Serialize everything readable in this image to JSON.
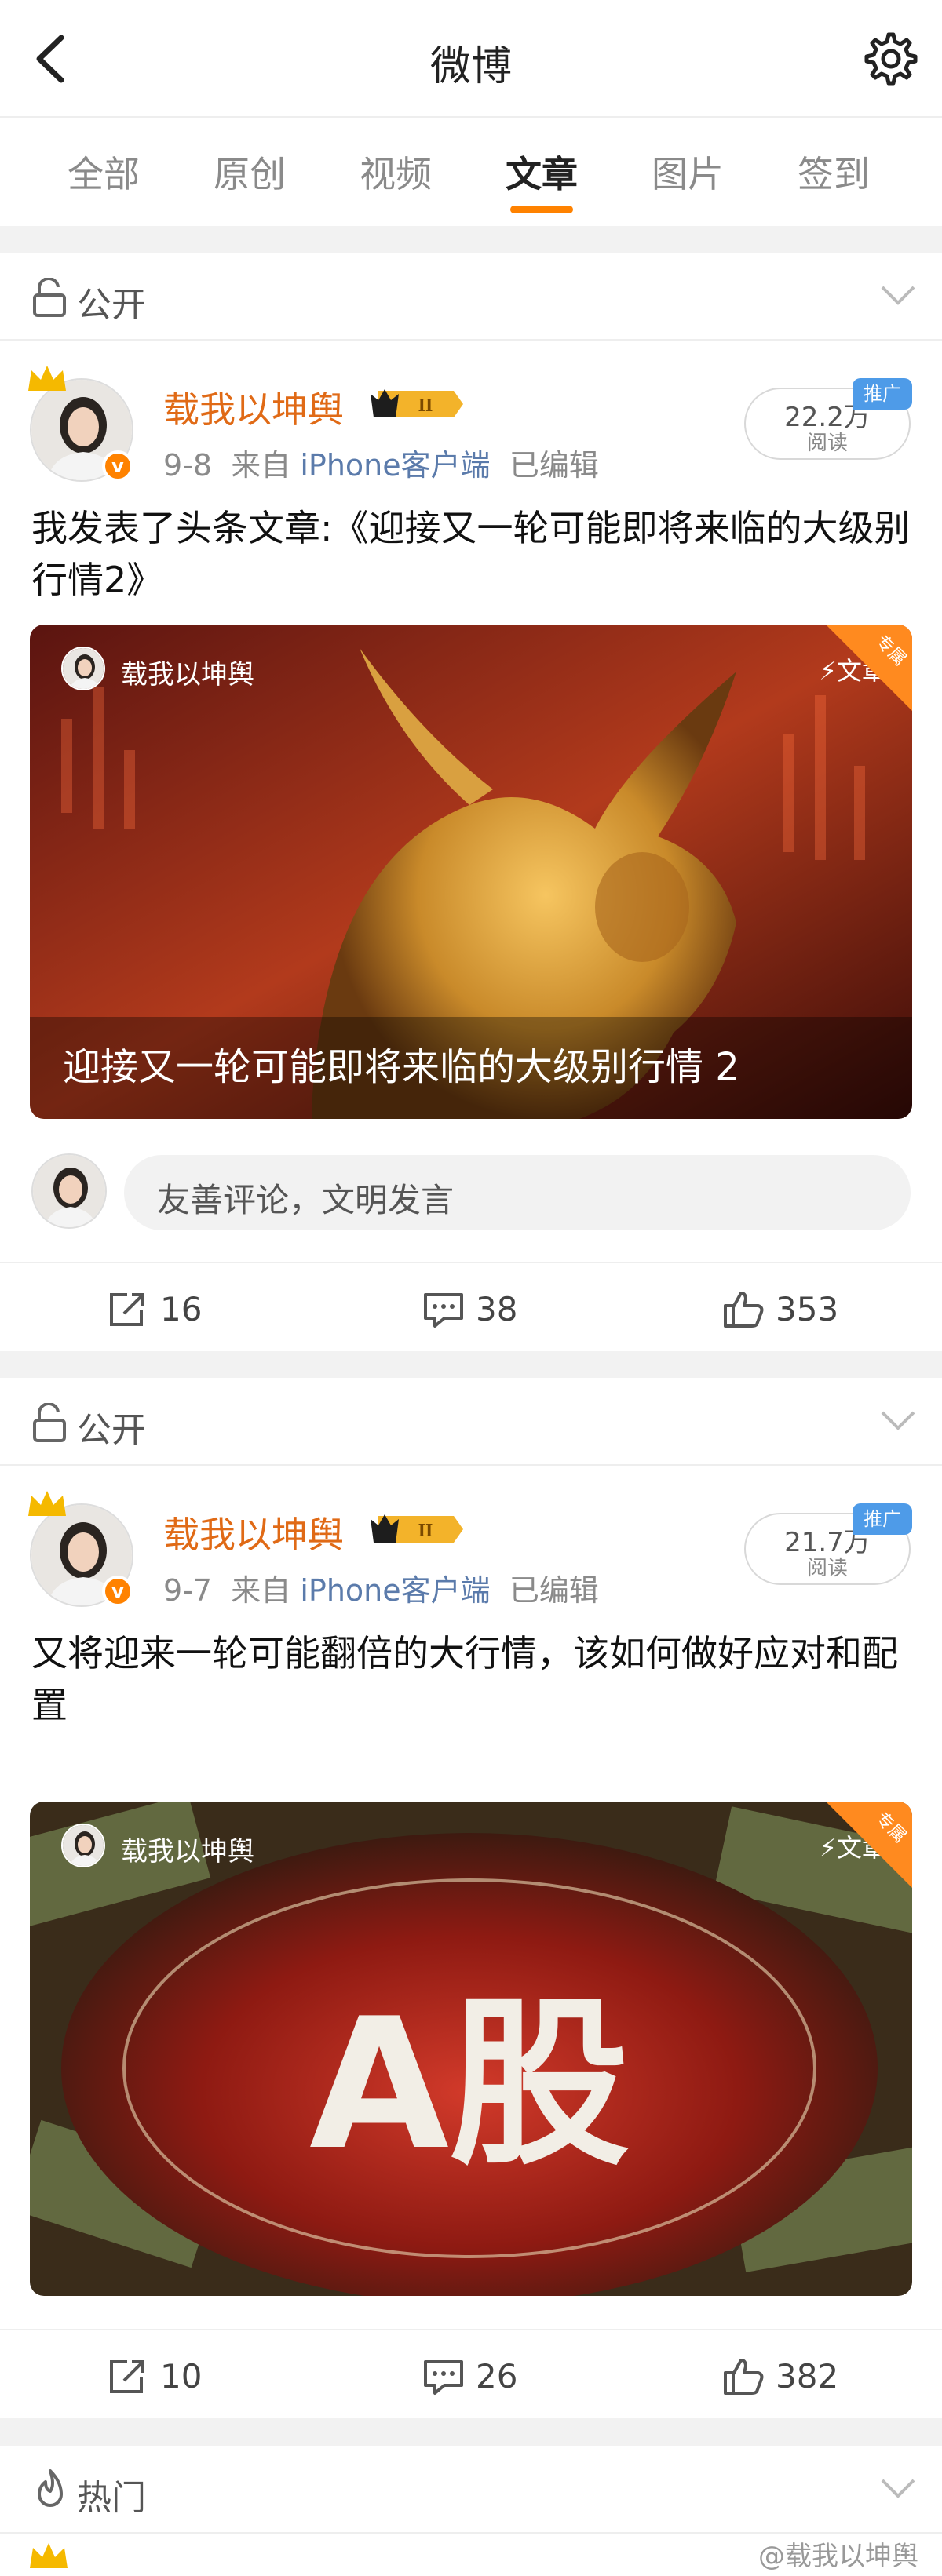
{
  "nav": {
    "title": "微博"
  },
  "tabs": [
    {
      "label": "全部"
    },
    {
      "label": "原创"
    },
    {
      "label": "视频"
    },
    {
      "label": "文章"
    },
    {
      "label": "图片"
    },
    {
      "label": "签到"
    }
  ],
  "active_tab": "文章",
  "posts": [
    {
      "visibility": "公开",
      "username": "载我以坤舆",
      "level": "II",
      "date": "9-8",
      "source_prefix": "来自",
      "source": "iPhone客户端",
      "edited": "已编辑",
      "reads": "22.2万",
      "reads_label": "阅读",
      "promo": "推广",
      "text": "我发表了头条文章:《迎接又一轮可能即将来临的大级别行情2》",
      "article": {
        "author": "载我以坤舆",
        "type": "文章",
        "corner": "专属",
        "title": "迎接又一轮可能即将来临的大级别行情 2"
      },
      "comment_placeholder": "友善评论，文明发言",
      "shares": "16",
      "comments": "38",
      "likes": "353"
    },
    {
      "visibility": "公开",
      "username": "载我以坤舆",
      "level": "II",
      "date": "9-7",
      "source_prefix": "来自",
      "source": "iPhone客户端",
      "edited": "已编辑",
      "reads": "21.7万",
      "reads_label": "阅读",
      "promo": "推广",
      "text": "又将迎来一轮可能翻倍的大行情，该如何做好应对和配置",
      "article": {
        "author": "载我以坤舆",
        "type": "文章",
        "corner": "专属",
        "title": "A股"
      },
      "shares": "10",
      "comments": "26",
      "likes": "382"
    }
  ],
  "hot_section": {
    "label": "热门"
  },
  "watermark": "@载我以坤舆",
  "colors": {
    "accent": "#ff8200",
    "username": "#e06a16",
    "source_link": "#5b7bab",
    "promo": "#4e9be8"
  },
  "icons": [
    "back-arrow-icon",
    "gear-icon",
    "lock-icon",
    "chevron-down-icon",
    "crown-icon",
    "verified-icon",
    "share-icon",
    "comment-icon",
    "like-icon",
    "fire-icon"
  ]
}
